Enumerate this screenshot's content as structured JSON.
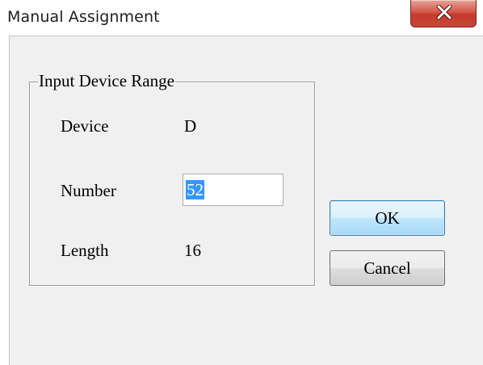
{
  "window": {
    "title": "Manual Assignment",
    "close_icon": "close-x-icon"
  },
  "group": {
    "legend": "Input Device Range",
    "device_label": "Device",
    "device_value": "D",
    "number_label": "Number",
    "number_value": "52",
    "length_label": "Length",
    "length_value": "16"
  },
  "buttons": {
    "ok_label": "OK",
    "cancel_label": "Cancel"
  },
  "colors": {
    "close_button": "#c8473a",
    "selection": "#3399ff",
    "default_button_border": "#3c7fb1"
  }
}
